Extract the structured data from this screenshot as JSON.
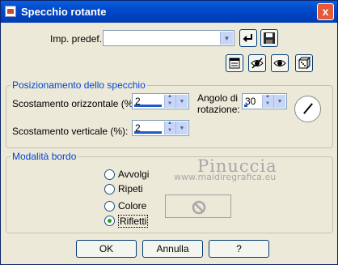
{
  "window": {
    "title": "Specchio rotante",
    "close_glyph": "x"
  },
  "preset": {
    "label": "Imp. predef.:",
    "value": ""
  },
  "icons": {
    "preset_apply": "return-arrow-icon",
    "preset_save": "save-disk-icon",
    "row_icons": [
      "preview-window-icon",
      "eye-toggle-icon",
      "eye-icon",
      "dice-randomize-icon"
    ]
  },
  "mirror_group": {
    "title": "Posizionamento dello specchio",
    "horizontal_label": "Scostamento orizzontale (%):",
    "horizontal_value": "2",
    "vertical_label": "Scostamento verticale (%):",
    "vertical_value": "2",
    "angle_label_line1": "Angolo di",
    "angle_label_line2": "rotazione:",
    "angle_value": "30"
  },
  "edge_group": {
    "title": "Modalità bordo",
    "options": [
      "Avvolgi",
      "Ripeti",
      "Colore",
      "Rifletti"
    ],
    "selected": "Rifletti"
  },
  "watermark": {
    "line1": "Pinuccia",
    "line2": "www.maidiregrafica.eu"
  },
  "buttons": {
    "ok": "OK",
    "cancel": "Annulla",
    "help": "?"
  },
  "colors": {
    "group_title": "#0046d5",
    "radio_selected": "#21a121",
    "titlebar": "#0047c7"
  }
}
